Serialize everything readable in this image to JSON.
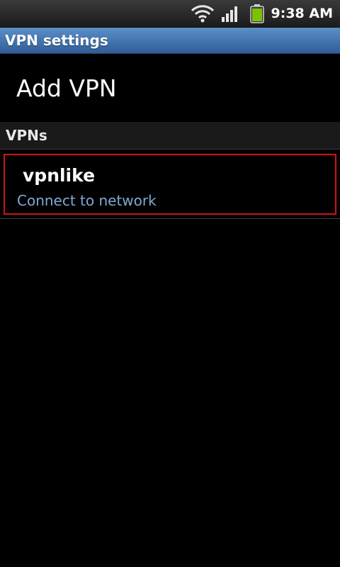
{
  "status_bar": {
    "time": "9:38 AM",
    "icons": [
      "wifi-icon",
      "signal-icon",
      "battery-icon"
    ],
    "battery_color": "#7cc100"
  },
  "title_bar": {
    "title": "VPN settings"
  },
  "add_vpn": {
    "label": "Add VPN"
  },
  "vpn_section": {
    "header": "VPNs",
    "items": [
      {
        "name": "vpnlike",
        "status": "Connect to network"
      }
    ]
  },
  "colors": {
    "title_bar": "#3f73ad",
    "highlight_border": "#d0121c",
    "status_text": "#7fa9d2"
  }
}
